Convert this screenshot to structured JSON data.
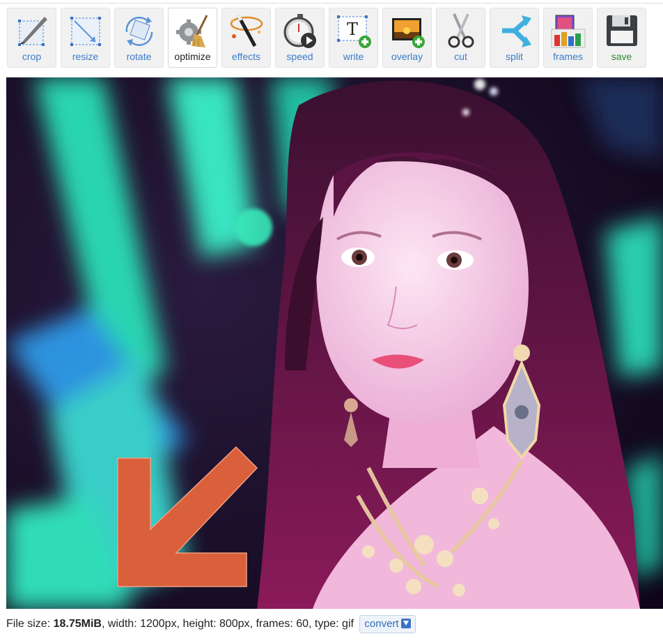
{
  "toolbar": {
    "tools": [
      {
        "id": "crop",
        "label": "crop",
        "icon": "crop-icon"
      },
      {
        "id": "resize",
        "label": "resize",
        "icon": "resize-icon"
      },
      {
        "id": "rotate",
        "label": "rotate",
        "icon": "rotate-icon"
      },
      {
        "id": "optimize",
        "label": "optimize",
        "icon": "optimize-broom-icon",
        "active": true
      },
      {
        "id": "effects",
        "label": "effects",
        "icon": "magic-wand-icon"
      },
      {
        "id": "speed",
        "label": "speed",
        "icon": "stopwatch-icon"
      },
      {
        "id": "write",
        "label": "write",
        "icon": "add-text-icon"
      },
      {
        "id": "overlay",
        "label": "overlay",
        "icon": "add-image-icon"
      },
      {
        "id": "cut",
        "label": "cut",
        "icon": "scissors-icon"
      },
      {
        "id": "split",
        "label": "split",
        "icon": "split-arrow-icon"
      },
      {
        "id": "frames",
        "label": "frames",
        "icon": "frames-icon"
      },
      {
        "id": "save",
        "label": "save",
        "icon": "floppy-disk-icon"
      }
    ]
  },
  "info": {
    "file_size_label": "File size: ",
    "file_size": "18.75MiB",
    "details": ", width: 1200px, height: 800px, frames: 60, type: gif",
    "convert_label": "convert"
  },
  "colors": {
    "link": "#3a7bc8",
    "save": "#2e8b2e",
    "arrow": "#d9603b"
  }
}
